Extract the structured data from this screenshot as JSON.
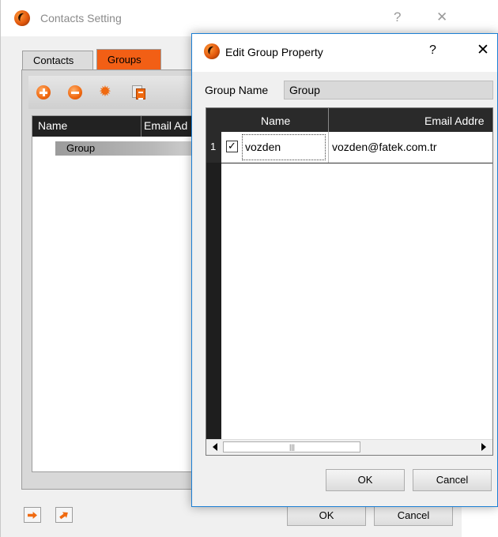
{
  "main_window": {
    "title": "Contacts Setting",
    "help_glyph": "?",
    "close_glyph": "✕",
    "tabs": [
      {
        "label": "Contacts"
      },
      {
        "label": "Groups"
      }
    ],
    "active_tab": "Groups",
    "toolbar_icons": [
      "add-icon",
      "remove-icon",
      "settings-gear-icon",
      "copy-icon"
    ],
    "columns": [
      "Name",
      "Email Ad"
    ],
    "groups": [
      {
        "name": "Group"
      }
    ],
    "bottom_icons": [
      "import-icon",
      "export-icon"
    ],
    "ok_label": "OK",
    "cancel_label": "Cancel",
    "accent_color": "#f25f15"
  },
  "edit_dialog": {
    "title": "Edit Group Property",
    "help_glyph": "?",
    "close_glyph": "✕",
    "group_name_label": "Group Name",
    "group_name_value": "Group",
    "columns": [
      "Name",
      "Email Addre"
    ],
    "rows": [
      {
        "index": "1",
        "checked": true,
        "checkbox_glyph": "✓",
        "name": "vozden",
        "email": "vozden@fatek.com.tr"
      }
    ],
    "scrollbar_grip": "|||",
    "ok_label": "OK",
    "cancel_label": "Cancel"
  }
}
